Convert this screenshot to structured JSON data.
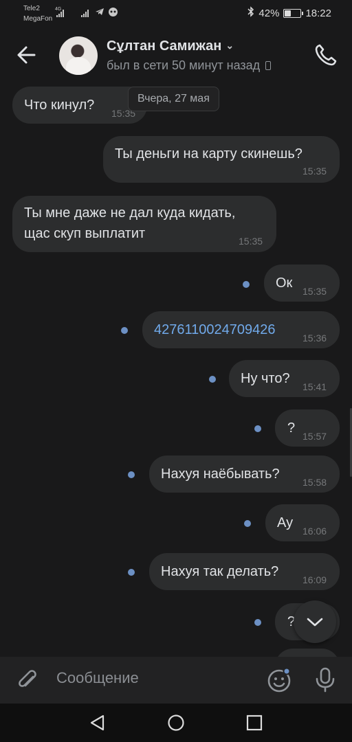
{
  "status_bar": {
    "carrier1": "Tele2",
    "carrier2": "MegaFon",
    "network": "4G",
    "battery_text": "42%",
    "battery_level": 0.42,
    "time": "18:22"
  },
  "header": {
    "name": "Сұлтан Самижан",
    "status": "был в сети 50 минут назад"
  },
  "date_label": "Вчера, 27 мая",
  "messages": [
    {
      "text": "Что кинул?",
      "time": "15:35",
      "dir": "in"
    },
    {
      "text": "Ты деньги на карту скинешь?",
      "time": "15:35",
      "dir": "out"
    },
    {
      "line1": "Ты мне даже не дал куда кидать,",
      "line2": "щас скуп выплатит",
      "time": "15:35",
      "dir": "in"
    },
    {
      "text": "Ок",
      "time": "15:35",
      "dir": "out"
    },
    {
      "text": "4276110024709426",
      "time": "15:36",
      "dir": "out"
    },
    {
      "text": "Ну что?",
      "time": "15:41",
      "dir": "out"
    },
    {
      "text": "?",
      "time": "15:57",
      "dir": "out"
    },
    {
      "text": "Нахуя наёбывать?",
      "time": "15:58",
      "dir": "out"
    },
    {
      "text": "Ау",
      "time": "16:06",
      "dir": "out"
    },
    {
      "text": "Нахуя так делать?",
      "time": "16:09",
      "dir": "out"
    },
    {
      "text": "?",
      "time": "",
      "dir": "out"
    }
  ],
  "composer": {
    "placeholder": "Сообщение"
  },
  "icons": {
    "back": "arrow-left-icon",
    "call": "phone-icon",
    "attach": "paperclip-icon",
    "emoji": "smile-icon",
    "mic": "microphone-icon",
    "scroll_down": "chevron-down-icon"
  },
  "colors": {
    "background": "#19191a",
    "bubble": "#2c2d2e",
    "link": "#71aaeb",
    "unread_dot": "#6c90c4"
  }
}
